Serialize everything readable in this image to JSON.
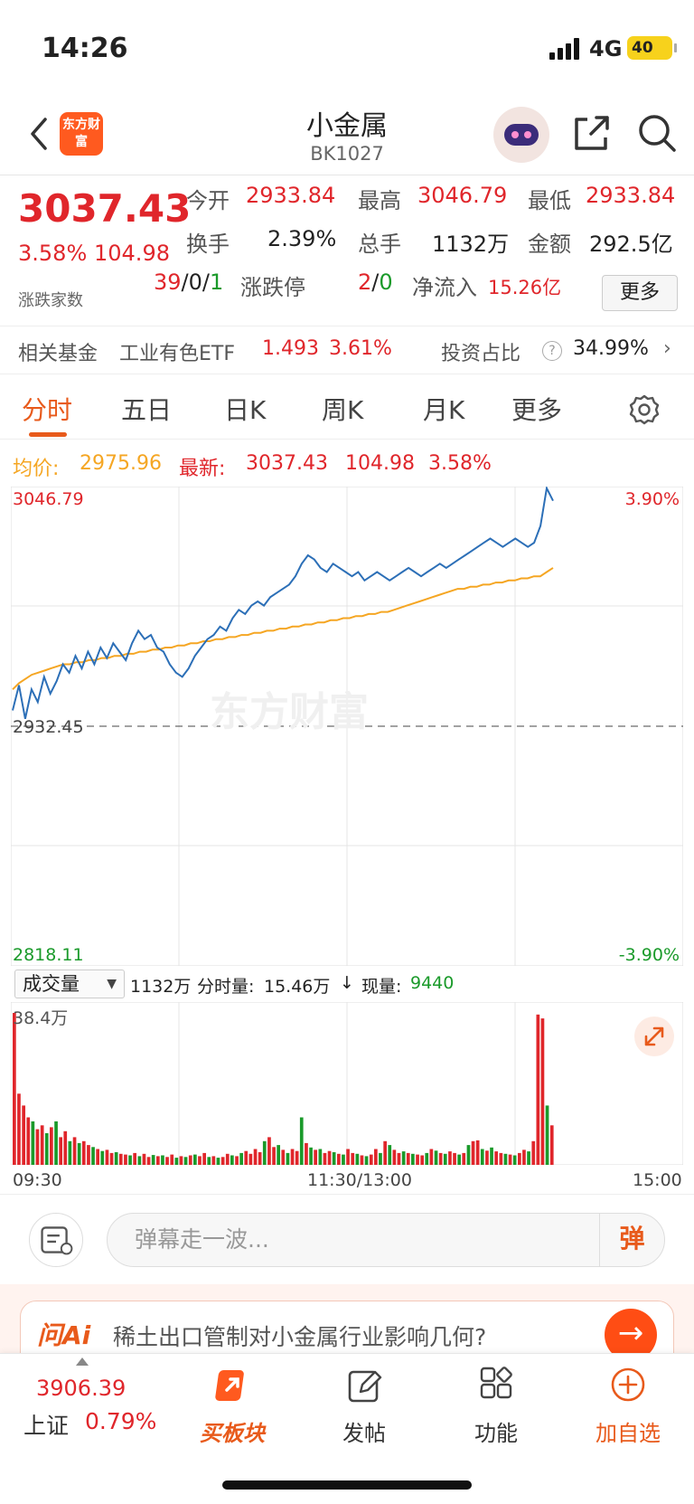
{
  "status_bar": {
    "time": "14:26",
    "network": "4G",
    "battery": "40"
  },
  "header": {
    "logo_text": "东方财富",
    "title": "小金属",
    "code": "BK1027"
  },
  "quote": {
    "price": "3037.43",
    "change_pct": "3.58%",
    "change_amt": "104.98",
    "open_label": "今开",
    "open": "2933.84",
    "high_label": "最高",
    "high": "3046.79",
    "low_label": "最低",
    "low": "2933.84",
    "turnover_label": "换手",
    "turnover": "2.39%",
    "volume_label": "总手",
    "volume": "1132万",
    "amount_label": "金额",
    "amount": "292.5亿",
    "breadth_label": "涨跌家数",
    "breadth_up": "39",
    "breadth_flat": "0",
    "breadth_down": "1",
    "limit_label": "涨跌停",
    "limit_up": "2",
    "limit_down": "0",
    "netflow_label": "净流入",
    "netflow": "15.26亿",
    "more_label": "更多"
  },
  "fund": {
    "label": "相关基金",
    "name": "工业有色ETF",
    "price": "1.493",
    "pct": "3.61%",
    "ratio_label": "投资占比",
    "ratio": "34.99%"
  },
  "tabs": [
    "分时",
    "五日",
    "日K",
    "周K",
    "月K",
    "更多"
  ],
  "legend": {
    "avg_label": "均价:",
    "avg": "2975.96",
    "latest_label": "最新:",
    "latest": "3037.43",
    "latest_chg": "104.98",
    "latest_pct": "3.58%"
  },
  "price_axis": {
    "top": "3046.79",
    "mid": "2932.45",
    "bottom": "2818.11",
    "top_pct": "3.90%",
    "bottom_pct": "-3.90%"
  },
  "volume_info": {
    "dropdown": "成交量",
    "total": "1132万",
    "minute_label": "分时量:",
    "minute": "15.46万",
    "now_label": "现量:",
    "now": "9440",
    "max": "38.4万"
  },
  "time_axis": {
    "start": "09:30",
    "mid": "11:30/13:00",
    "end": "15:00"
  },
  "colors": {
    "price_line": "#2c6fb7",
    "avg_line": "#f5a623",
    "up": "#e0262b",
    "down": "#1a9a2a",
    "accent": "#e85a1b"
  },
  "chart_data": {
    "type": "line",
    "title": "",
    "xlabel": "",
    "ylabel": "",
    "ylim": [
      2818.11,
      3046.79
    ],
    "x_range": [
      "09:30",
      "15:00"
    ],
    "series": [
      {
        "values": [
          2940,
          2952,
          2936,
          2950,
          2944,
          2956,
          2948,
          2954,
          2962,
          2958,
          2966,
          2960,
          2968,
          2962,
          2970,
          2965,
          2972,
          2968,
          2964,
          2972,
          2978,
          2974,
          2976,
          2970,
          2968,
          2962,
          2958,
          2956,
          2960,
          2966,
          2970,
          2974,
          2976,
          2980,
          2978,
          2984,
          2988,
          2986,
          2990,
          2992,
          2990,
          2994,
          2996,
          2998,
          3000,
          3004,
          3010,
          3014,
          3012,
          3008,
          3006,
          3010,
          3008,
          3006,
          3004,
          3006,
          3002,
          3004,
          3006,
          3004,
          3002,
          3004,
          3006,
          3008,
          3006,
          3004,
          3006,
          3008,
          3010,
          3008,
          3010,
          3012,
          3014,
          3016,
          3018,
          3020,
          3022,
          3020,
          3018,
          3020,
          3022,
          3020,
          3018,
          3020,
          3028,
          3046,
          3040
        ]
      },
      {
        "values": [
          2950,
          2953,
          2955,
          2957,
          2958,
          2959,
          2960,
          2961,
          2962,
          2962,
          2963,
          2963,
          2964,
          2964,
          2965,
          2965,
          2966,
          2966,
          2967,
          2967,
          2968,
          2968,
          2969,
          2969,
          2970,
          2970,
          2971,
          2971,
          2972,
          2972,
          2973,
          2973,
          2974,
          2974,
          2975,
          2975,
          2976,
          2976,
          2977,
          2977,
          2978,
          2978,
          2979,
          2979,
          2980,
          2980,
          2981,
          2981,
          2982,
          2982,
          2983,
          2983,
          2984,
          2984,
          2985,
          2985,
          2986,
          2986,
          2987,
          2987,
          2988,
          2989,
          2990,
          2991,
          2992,
          2993,
          2994,
          2995,
          2996,
          2997,
          2998,
          2998,
          2999,
          2999,
          3000,
          3000,
          3001,
          3001,
          3002,
          3002,
          3003,
          3003,
          3004,
          3004,
          3006,
          3008
        ]
      }
    ]
  },
  "volume_bars": [
    384,
    180,
    150,
    120,
    110,
    90,
    100,
    80,
    95,
    110,
    70,
    85,
    60,
    70,
    55,
    60,
    50,
    45,
    40,
    35,
    38,
    30,
    32,
    28,
    26,
    24,
    30,
    22,
    28,
    20,
    25,
    22,
    24,
    20,
    26,
    18,
    22,
    20,
    24,
    26,
    22,
    30,
    20,
    22,
    18,
    20,
    28,
    24,
    22,
    30,
    35,
    28,
    40,
    32,
    60,
    70,
    45,
    50,
    38,
    30,
    40,
    35,
    120,
    55,
    44,
    38,
    40,
    30,
    35,
    32,
    28,
    26,
    40,
    30,
    28,
    24,
    22,
    26,
    40,
    30,
    60,
    50,
    38,
    30,
    34,
    30,
    28,
    26,
    24,
    30,
    40,
    36,
    30,
    28,
    34,
    30,
    26,
    30,
    50,
    60,
    62,
    40,
    36,
    44,
    34,
    30,
    28,
    26,
    24,
    30,
    38,
    34,
    60,
    380,
    370,
    150,
    100
  ],
  "vol_colors": "rrrrgrrgrgrrgrgrrgrgrrgrrgrgrrgrgrrgrgrgrrgrgrrgrgrrrrgrrgrgrrgrgrgrrgrgrrgrgrrgrgrrgrgrrgrgrgrrgrgrrgrgrrgrgrrgrrrg",
  "danmaku": {
    "placeholder": "弹幕走一波...",
    "send": "弹"
  },
  "ai_banner": {
    "logo": "问Ai",
    "text": "稀土出口管制对小金属行业影响几何?"
  },
  "bottom_nav": {
    "index_value": "3906.39",
    "index_name": "上证",
    "index_pct": "0.79%",
    "items": [
      "买板块",
      "发帖",
      "功能",
      "加自选"
    ]
  }
}
